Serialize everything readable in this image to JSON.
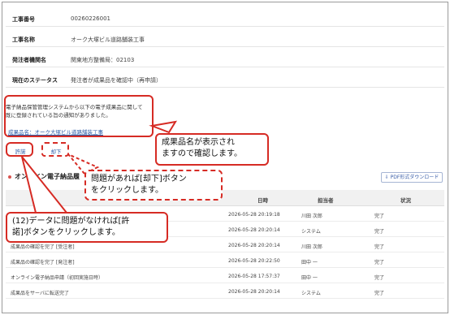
{
  "info": [
    {
      "label": "工事番号",
      "value": "00260226001"
    },
    {
      "label": "工事名称",
      "value": "オーク大塚ビル道路舗装工事"
    },
    {
      "label": "発注者機関名",
      "value": "関東地方整備局：02103"
    },
    {
      "label": "現在のステータス",
      "value": "発注者が成果品を確認中（再申請）"
    }
  ],
  "notice": {
    "line1": "電子納品保管管理システムから以下の電子成果品に関して",
    "line2": "既に登録されている旨の通知がありました。",
    "product_link": "成果品名：オーク大塚ビル道路舗装工事"
  },
  "actions": {
    "approve": "許諾",
    "reject": "却下"
  },
  "section": {
    "title": "オンライン電子納品履",
    "pdf_button": "PDF形式ダウンロード"
  },
  "table": {
    "headers": [
      "日時",
      "担当者",
      "状況"
    ],
    "rows": [
      {
        "name": "",
        "datetime": "2026-05-28 20:19:18",
        "person": "川田 次郎",
        "status": "完了"
      },
      {
        "name": "",
        "datetime": "2026-05-28 20:20:14",
        "person": "システム",
        "status": "完了"
      },
      {
        "name": "成果品の確認を完了 [受注者]",
        "datetime": "2026-05-28 20:20:14",
        "person": "川田 次郎",
        "status": "完了"
      },
      {
        "name": "成果品の確認を完了 [発注者]",
        "datetime": "2026-05-28 20:22:50",
        "person": "田中 一",
        "status": "完了"
      },
      {
        "name": "オンライン電子納品申請（初回実施日時）",
        "datetime": "2026-05-28 17:57:37",
        "person": "田中 一",
        "status": "完了"
      },
      {
        "name": "成果品をサーバに転送完了",
        "datetime": "2026-05-28 20:20:14",
        "person": "システム",
        "status": "完了"
      }
    ]
  },
  "callouts": {
    "product_name_line1": "成果品名が表示され",
    "product_name_line2": "ますので確認します。",
    "reject_line1": "問題があれば[却下]ボタン",
    "reject_line2": "をクリックします。",
    "approve_line1": "(12)データに問題がなければ[許",
    "approve_line2": "諾]ボタンをクリックします。"
  },
  "colors": {
    "annotation_red": "#d62b24",
    "link_blue": "#2b5aa6"
  }
}
